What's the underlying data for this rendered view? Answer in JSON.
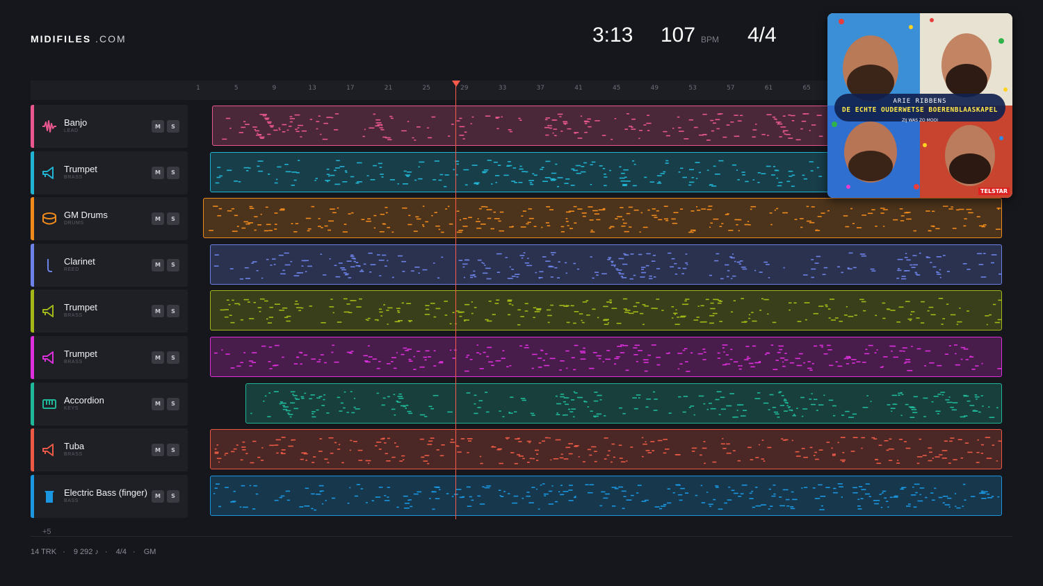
{
  "header": {
    "logo_bold": "MIDIFILES",
    "logo_light": ".COM",
    "time": "3:13",
    "tempo": "107",
    "tempo_unit": "BPM",
    "signature": "4/4"
  },
  "ruler": {
    "bars": [
      "1",
      "5",
      "9",
      "13",
      "17",
      "21",
      "25",
      "29",
      "33",
      "37",
      "41",
      "45",
      "49",
      "53",
      "57",
      "61",
      "65"
    ]
  },
  "playhead": {
    "bar": 28
  },
  "tracks": [
    {
      "name": "Banjo",
      "category": "LEAD",
      "color": "#e8578f",
      "icon": "waveform-icon",
      "mute": "M",
      "solo": "S"
    },
    {
      "name": "Trumpet",
      "category": "BRASS",
      "color": "#21b4d2",
      "icon": "horn-icon",
      "mute": "M",
      "solo": "S"
    },
    {
      "name": "GM Drums",
      "category": "DRUMS",
      "color": "#f08a1c",
      "icon": "drum-icon",
      "mute": "M",
      "solo": "S"
    },
    {
      "name": "Clarinet",
      "category": "REED",
      "color": "#6c82e6",
      "icon": "clarinet-icon",
      "mute": "M",
      "solo": "S"
    },
    {
      "name": "Trumpet",
      "category": "BRASS",
      "color": "#a3b818",
      "icon": "horn-icon",
      "mute": "M",
      "solo": "S"
    },
    {
      "name": "Trumpet",
      "category": "BRASS",
      "color": "#de2fdc",
      "icon": "horn-icon",
      "mute": "M",
      "solo": "S"
    },
    {
      "name": "Accordion",
      "category": "KEYS",
      "color": "#1fb89a",
      "icon": "keyboard-icon",
      "mute": "M",
      "solo": "S"
    },
    {
      "name": "Tuba",
      "category": "BRASS",
      "color": "#ec5a45",
      "icon": "horn-icon",
      "mute": "M",
      "solo": "S"
    },
    {
      "name": "Electric Bass (finger)",
      "category": "BASS",
      "color": "#1a97e0",
      "icon": "bass-icon",
      "mute": "M",
      "solo": "S"
    }
  ],
  "more_tracks": "+5",
  "footer": {
    "tracks": "14 TRK",
    "notes": "9 292 ♪",
    "signature": "4/4",
    "standard": "GM"
  },
  "cover": {
    "artist": "ARIE RIBBENS",
    "album": "DE ECHTE OUDERWETSE BOERENBLAASKAPEL",
    "song": "ZIJ WAS ZO MOOI",
    "label": "TELSTAR"
  }
}
